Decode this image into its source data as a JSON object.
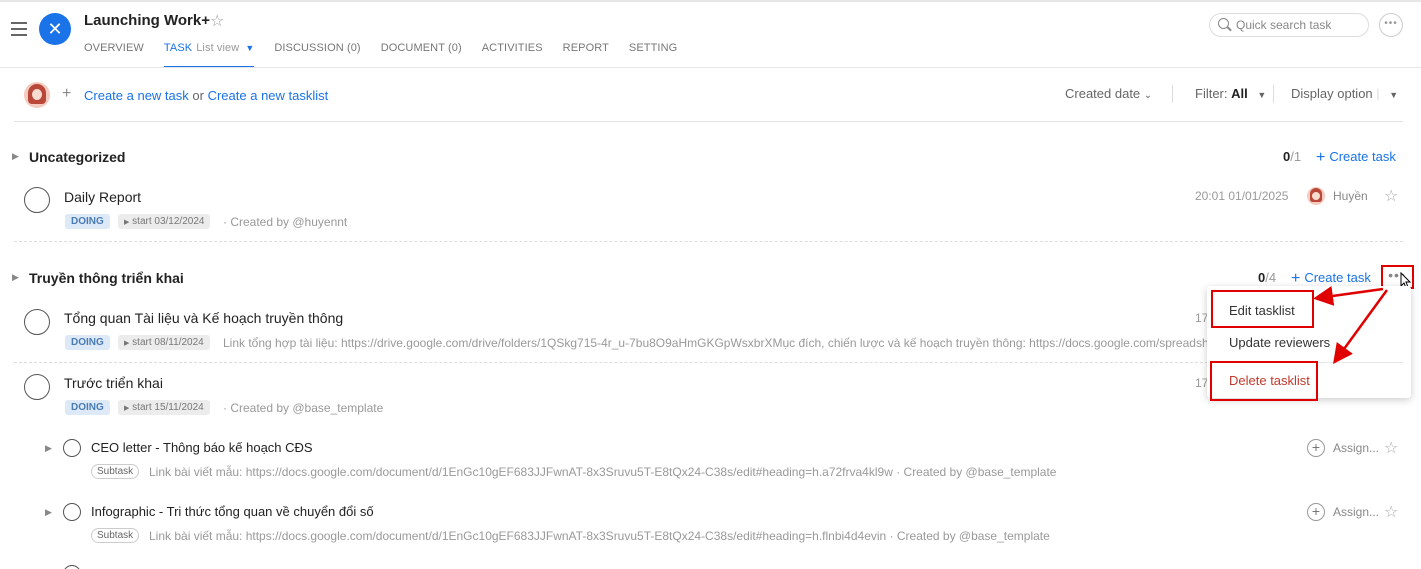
{
  "header": {
    "app_title": "Launching Work+",
    "tabs": [
      {
        "label": "OVERVIEW"
      },
      {
        "label": "TASK",
        "sub": "List view"
      },
      {
        "label": "DISCUSSION (0)"
      },
      {
        "label": "DOCUMENT (0)"
      },
      {
        "label": "ACTIVITIES"
      },
      {
        "label": "REPORT"
      },
      {
        "label": "SETTING"
      }
    ],
    "search_placeholder": "Quick search task"
  },
  "toolbar": {
    "create_task": "Create a new task",
    "or": "or",
    "create_tasklist": "Create a new tasklist",
    "sort_label": "Created date",
    "filter_label": "Filter:",
    "filter_value": "All",
    "display_option": "Display option"
  },
  "groups": [
    {
      "title": "Uncategorized",
      "count_done": "0",
      "count_total": "/1",
      "create_task": "Create task",
      "tasks": [
        {
          "title": "Daily Report",
          "status": "DOING",
          "start": "start 03/12/2024",
          "meta": "· Created by @huyennt",
          "date": "20:01 01/01/2025",
          "assignee": "Huyền"
        }
      ]
    },
    {
      "title": "Truyền thông triển khai",
      "count_done": "0",
      "count_total": "/4",
      "create_task": "Create task",
      "tasks": [
        {
          "title": "Tổng quan Tài liệu và Kế hoạch truyền thông",
          "status": "DOING",
          "start": "start 08/11/2024",
          "meta": "Link tổng hợp tài liệu: https://drive.google.com/drive/folders/1QSkg715-4r_u-7bu8O9aHmGKGpWsxbrXMục đích, chiến lược và kế hoạch truyền thông: https://docs.google.com/spreadsh",
          "date": "17"
        },
        {
          "title": "Trước triển khai",
          "status": "DOING",
          "start": "start 15/11/2024",
          "meta": "· Created by @base_template",
          "date": "17"
        }
      ],
      "subtasks": [
        {
          "title": "CEO letter - Thông báo kế hoạch CĐS",
          "badge": "Subtask",
          "meta": "Link bài viết mẫu: https://docs.google.com/document/d/1EnGc10gEF683JJFwnAT-8x3Sruvu5T-E8tQx24-C38s/edit#heading=h.a72frva4kl9w · Created by @base_template",
          "assignee": "Assign..."
        },
        {
          "title": "Infographic - Tri thức tổng quan về chuyển đổi số",
          "badge": "Subtask",
          "meta": "Link bài viết mẫu: https://docs.google.com/document/d/1EnGc10gEF683JJFwnAT-8x3Sruvu5T-E8tQx24-C38s/edit#heading=h.flnbi4d4evin · Created by @base_template",
          "assignee": "Assign..."
        }
      ]
    }
  ],
  "context_menu": {
    "items": [
      "Edit tasklist",
      "Update reviewers",
      "Delete tasklist"
    ]
  },
  "colors": {
    "accent": "#1a73e8",
    "annotation_red": "#e00000",
    "danger": "#c0392b"
  }
}
